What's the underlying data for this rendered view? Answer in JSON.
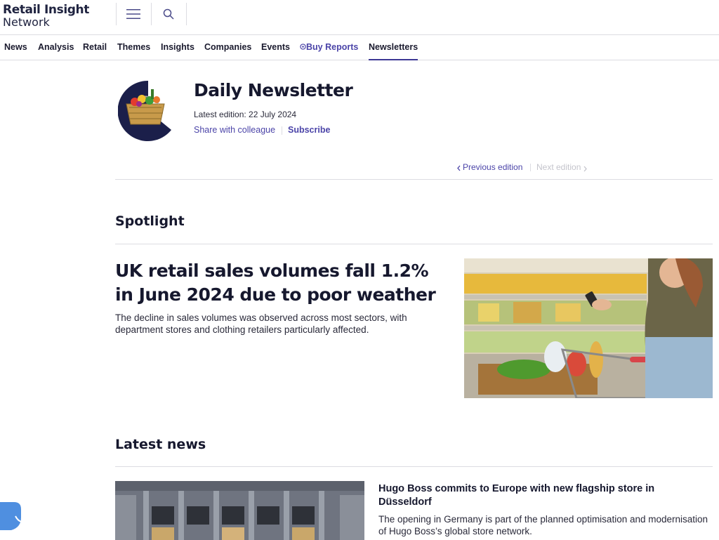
{
  "brand": {
    "line1": "Retail Insight",
    "line2": "Network"
  },
  "header": {
    "menu_icon": "hamburger-menu-icon",
    "search_icon": "search-icon"
  },
  "nav": {
    "items": [
      {
        "label": "News"
      },
      {
        "label": "Analysis"
      },
      {
        "label": "Retail"
      },
      {
        "label": "Themes"
      },
      {
        "label": "Insights"
      },
      {
        "label": "Companies"
      },
      {
        "label": "Events"
      },
      {
        "label": "Buy Reports",
        "icon": "buy-reports-icon"
      },
      {
        "label": "Newsletters",
        "active": true
      }
    ]
  },
  "newsletter": {
    "title": "Daily Newsletter",
    "edition": "Latest edition: 22 July 2024",
    "share": "Share with colleague",
    "subscribe": "Subscribe",
    "previous": "Previous edition",
    "next": "Next edition",
    "image_icon": "grocery-basket-image"
  },
  "spotlight": {
    "section_title": "Spotlight",
    "headline": "UK retail sales volumes fall 1.2% in June 2024 due to poor weather",
    "description": "The decline in sales volumes was observed across most sectors, with department stores and clothing retailers particularly affected."
  },
  "latest": {
    "section_title": "Latest news",
    "items": [
      {
        "headline": "Hugo Boss commits to Europe with new flagship store in Düsseldorf",
        "description": "The opening in Germany is part of the planned optimisation and modernisation of Hugo Boss’s global store network."
      }
    ]
  },
  "colors": {
    "accent": "#4b44a8",
    "text": "#16182e",
    "divider": "#dcdce2",
    "disabled": "#c4c4cc"
  }
}
